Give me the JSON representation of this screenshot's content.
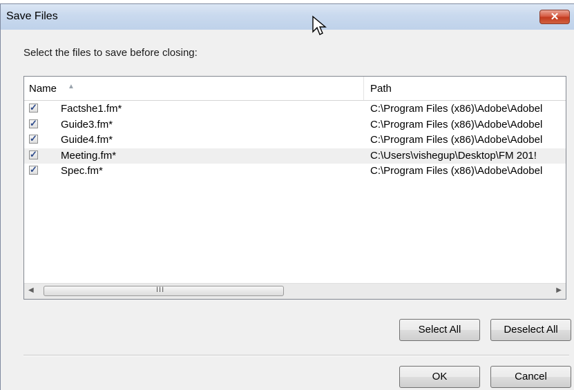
{
  "window": {
    "title": "Save Files",
    "close_glyph": "✕"
  },
  "prompt": "Select the files to save before closing:",
  "list": {
    "columns": {
      "name": "Name",
      "path": "Path"
    },
    "sort_indicator": "▲",
    "rows": [
      {
        "checked": true,
        "name": "Factshe1.fm*",
        "path": "C:\\Program Files (x86)\\Adobe\\Adobel"
      },
      {
        "checked": true,
        "name": "Guide3.fm*",
        "path": "C:\\Program Files (x86)\\Adobe\\Adobel"
      },
      {
        "checked": true,
        "name": "Guide4.fm*",
        "path": "C:\\Program Files (x86)\\Adobe\\Adobel"
      },
      {
        "checked": true,
        "name": "Meeting.fm*",
        "path": "C:\\Users\\vishegup\\Desktop\\FM 201!"
      },
      {
        "checked": true,
        "name": "Spec.fm*",
        "path": "C:\\Program Files (x86)\\Adobe\\Adobel"
      }
    ],
    "check_glyph": "✓",
    "scrollbar": {
      "left_arrow": "◀",
      "right_arrow": "▶",
      "grip": "III"
    }
  },
  "buttons": {
    "select_all": "Select All",
    "deselect_all": "Deselect All",
    "ok": "OK",
    "cancel": "Cancel"
  },
  "icons": {
    "close": "close-icon",
    "cursor": "mouse-pointer-icon",
    "sort": "sort-ascending-icon"
  }
}
